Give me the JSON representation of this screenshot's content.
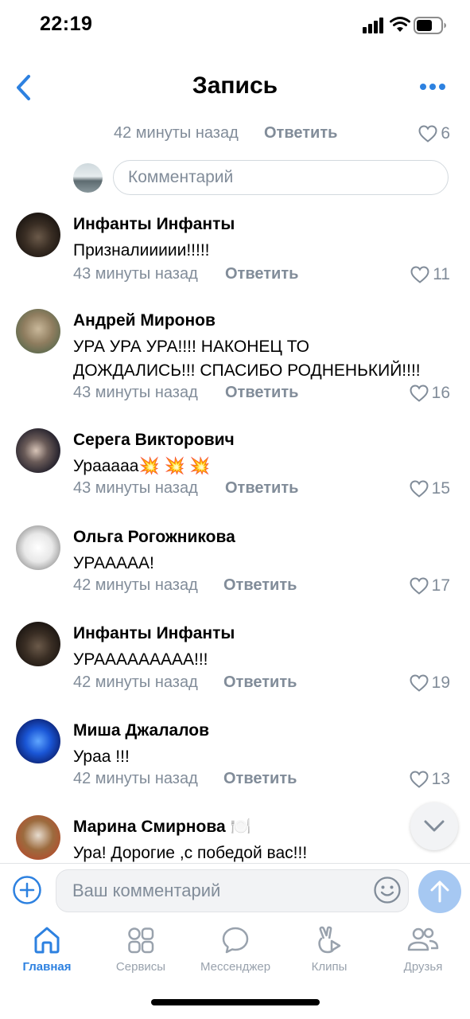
{
  "status_bar": {
    "time": "22:19"
  },
  "header": {
    "title": "Запись"
  },
  "top_comment_meta": {
    "time": "42 минуты назад",
    "reply": "Ответить",
    "likes": "6"
  },
  "reply_input": {
    "placeholder": "Комментарий"
  },
  "comments": [
    {
      "author": "Инфанты Инфанты",
      "text": "Признaлиииии!!!!!",
      "time": "43 минуты назад",
      "reply": "Ответить",
      "likes": "11"
    },
    {
      "author": "Андрей Миронов",
      "text": "УРА УРА УРА!!!! НАКОНЕЦ ТО\nДОЖДАЛИСЬ!!! СПАСИБО РОДНЕНЬКИЙ!!!!",
      "time": "43 минуты назад",
      "reply": "Ответить",
      "likes": "16"
    },
    {
      "author": "Серега Викторович",
      "text": "Урааааа💥 💥 💥",
      "time": "43 минуты назад",
      "reply": "Ответить",
      "likes": "15"
    },
    {
      "author": "Ольга Рогожникова",
      "text": "УРААААА!",
      "time": "42 минуты назад",
      "reply": "Ответить",
      "likes": "17"
    },
    {
      "author": "Инфанты Инфанты",
      "text": "УРААААААААА!!!",
      "time": "42 минуты назад",
      "reply": "Ответить",
      "likes": "19"
    },
    {
      "author": "Миша Джалалов",
      "text": "Ураа !!!",
      "time": "42 минуты назад",
      "reply": "Ответить",
      "likes": "13"
    },
    {
      "author": "Марина Смирнова 🍽️",
      "text": "Ура! Дорогие ,с победой вас!!!",
      "time": "",
      "reply": "",
      "likes": ""
    }
  ],
  "composer": {
    "placeholder": "Ваш комментарий"
  },
  "tabs": [
    {
      "label": "Главная",
      "icon": "home-icon",
      "active": true
    },
    {
      "label": "Сервисы",
      "icon": "services-icon"
    },
    {
      "label": "Мессенджер",
      "icon": "messenger-icon"
    },
    {
      "label": "Клипы",
      "icon": "clips-icon"
    },
    {
      "label": "Друзья",
      "icon": "friends-icon"
    }
  ],
  "colors": {
    "accent": "#2d81e0",
    "secondary_text": "#818c99",
    "tab_inactive": "#99a2ad",
    "send_disabled": "#a6c8f2"
  }
}
